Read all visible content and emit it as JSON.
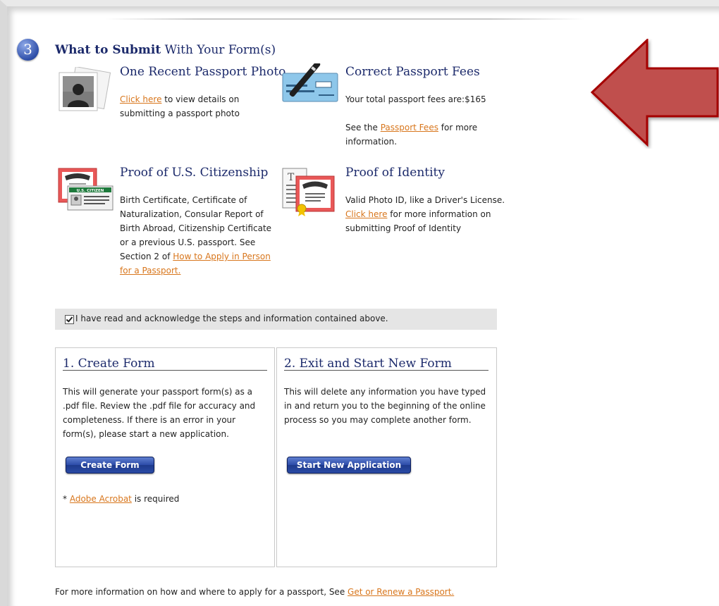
{
  "section": {
    "number": "3",
    "title_bold": "What to Submit",
    "title_rest": " With Your Form(s)"
  },
  "items": {
    "photo": {
      "heading": "One Recent Passport Photo",
      "link": "Click here",
      "text_after": " to view details on submitting a passport photo"
    },
    "fees": {
      "heading": "Correct Passport Fees",
      "total_text": "Your total passport fees are:$165",
      "see_prefix": "See the ",
      "link": "Passport Fees",
      "see_suffix": " for more information."
    },
    "citizenship": {
      "heading": "Proof of U.S. Citizenship",
      "text": "Birth Certificate, Certificate of Naturalization, Consular Report of Birth Abroad, Citizenship Certificate or a previous U.S. passport. See Section 2 of ",
      "link": "How to Apply in Person for a Passport.",
      "badge": "U.S. CITIZEN"
    },
    "identity": {
      "heading": "Proof of Identity",
      "text_before": "Valid Photo ID, like a Driver's License. ",
      "link": "Click here",
      "text_after": " for more information on submitting Proof of Identity"
    }
  },
  "acknowledge": {
    "checked": true,
    "label": "I have read and acknowledge the steps and information contained above."
  },
  "panels": {
    "create": {
      "title": "1. Create Form",
      "text": "This will generate your passport form(s) as a .pdf file. Review the .pdf file for accuracy and completeness. If there is an error in your form(s), please start a new application.",
      "button": "Create Form",
      "note_prefix": "* ",
      "note_link": "Adobe Acrobat",
      "note_suffix": " is required"
    },
    "exit": {
      "title": "2. Exit and Start New Form",
      "text": "This will delete any information you have typed in and return you to the beginning of the online process so you may complete another form.",
      "button": "Start New Application"
    }
  },
  "footer": {
    "text": "For more information on how and where to apply for a passport, See ",
    "link": "Get or Renew a Passport."
  },
  "colors": {
    "heading": "#1c2a6b",
    "link": "#d8761c",
    "arrow": "#c0504d",
    "arrow_border": "#a50000",
    "button": "#2c4ba8"
  }
}
